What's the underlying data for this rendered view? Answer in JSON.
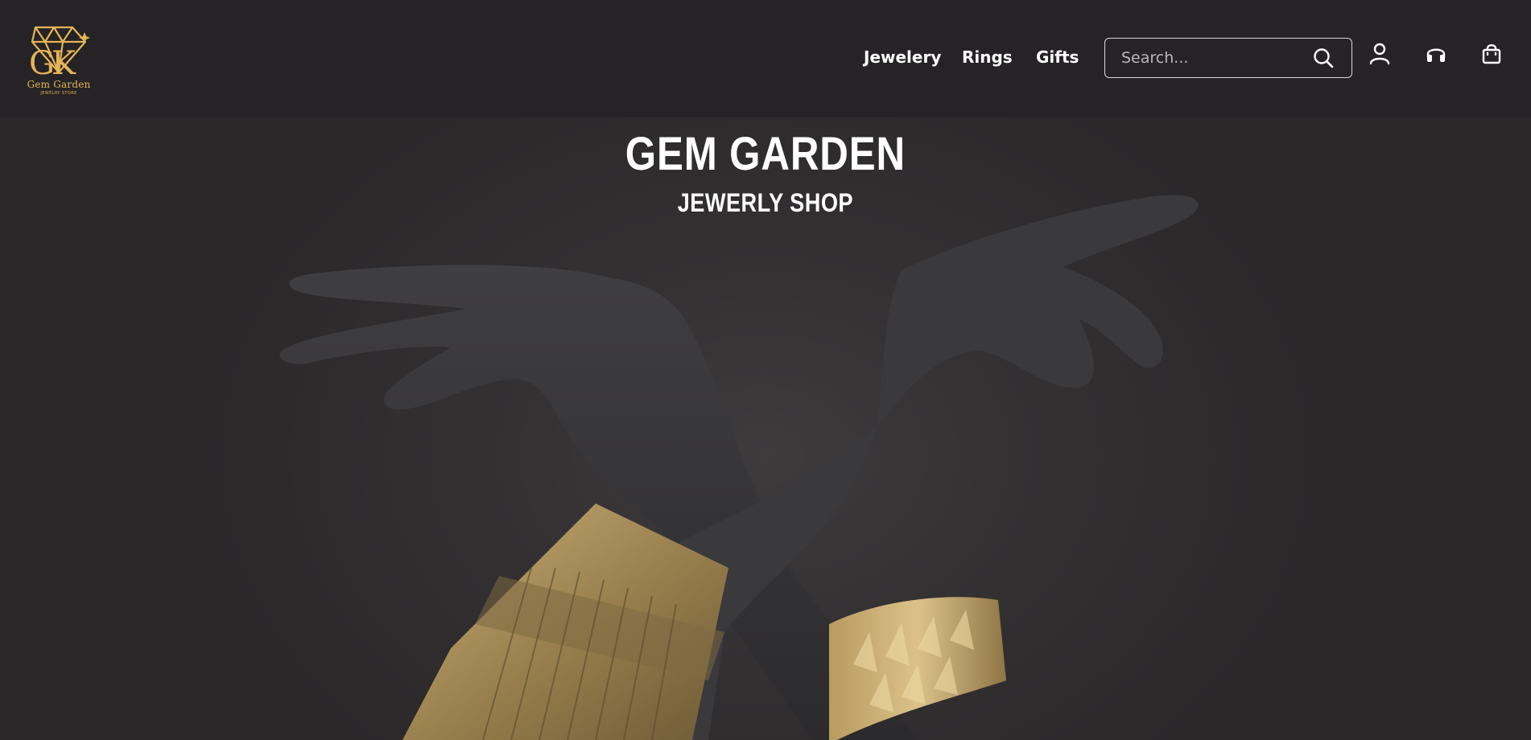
{
  "brand": {
    "name": "Gem Garden",
    "tagline": "Jewelry Store",
    "accent_color": "#e5b457",
    "logo_icon": "diamond-monogram-icon"
  },
  "nav": {
    "items": [
      {
        "label": "Jewelery"
      },
      {
        "label": "Rings"
      },
      {
        "label": "Gifts"
      }
    ]
  },
  "search": {
    "placeholder": "Search...",
    "value": "",
    "icon": "search-icon"
  },
  "header_icons": {
    "account": "user-icon",
    "support": "headphones-icon",
    "cart": "shopping-bag-icon"
  },
  "hero": {
    "title": "GEM GARDEN",
    "subtitle": "JEWERLY SHOP",
    "image": "hands-with-gold-bracelets"
  },
  "colors": {
    "header_bg": "#252325",
    "hero_bg": "#333132",
    "text": "#ffffff"
  }
}
